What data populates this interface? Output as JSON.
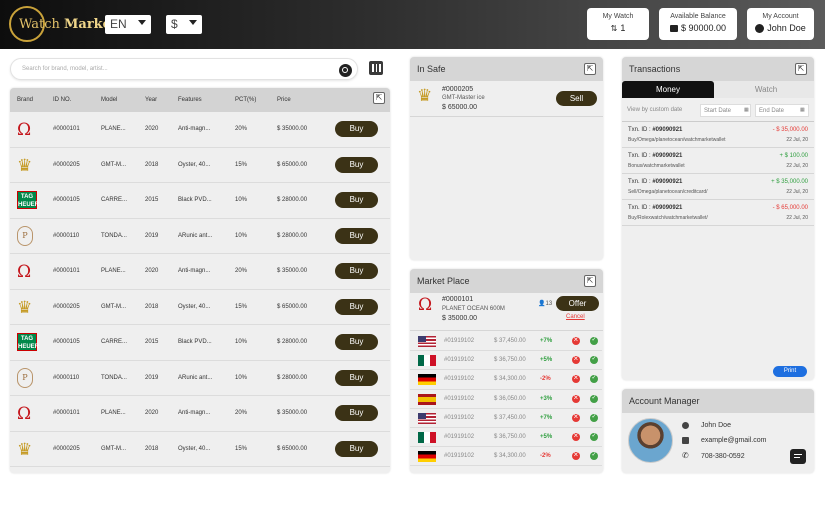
{
  "brand": {
    "logo_prefix": "W",
    "logo_rest": "atch",
    "logo_bold": "Market"
  },
  "selectors": {
    "language": "EN",
    "currency": "$"
  },
  "header_cards": {
    "watch": {
      "label": "My Watch",
      "value": "1"
    },
    "balance": {
      "label": "Available Balance",
      "value": "$ 90000.00"
    },
    "account": {
      "label": "My Account",
      "value": "John Doe"
    }
  },
  "search": {
    "placeholder": "Search for brand, model, artist..."
  },
  "table": {
    "headers": [
      "Brand",
      "ID NO.",
      "Model",
      "Year",
      "Features",
      "PCT(%)",
      "Price"
    ],
    "buy_label": "Buy",
    "rows": [
      {
        "brand": "omega",
        "id": "#0000101",
        "model": "PLANE...",
        "year": "2020",
        "features": "Anti-magn...",
        "pct": "20%",
        "price": "$ 35000.00"
      },
      {
        "brand": "rolex",
        "id": "#0000205",
        "model": "GMT-M...",
        "year": "2018",
        "features": "Oyster, 40...",
        "pct": "15%",
        "price": "$ 65000.00"
      },
      {
        "brand": "tag",
        "id": "#0000105",
        "model": "CARRE...",
        "year": "2015",
        "features": "Black PVD...",
        "pct": "10%",
        "price": "$ 28000.00"
      },
      {
        "brand": "pp",
        "id": "#0000110",
        "model": "TONDA...",
        "year": "2019",
        "features": "ARunic ant...",
        "pct": "10%",
        "price": "$ 28000.00"
      },
      {
        "brand": "omega",
        "id": "#0000101",
        "model": "PLANE...",
        "year": "2020",
        "features": "Anti-magn...",
        "pct": "20%",
        "price": "$ 35000.00"
      },
      {
        "brand": "rolex",
        "id": "#0000205",
        "model": "GMT-M...",
        "year": "2018",
        "features": "Oyster, 40...",
        "pct": "15%",
        "price": "$ 65000.00"
      },
      {
        "brand": "tag",
        "id": "#0000105",
        "model": "CARRE...",
        "year": "2015",
        "features": "Black PVD...",
        "pct": "10%",
        "price": "$ 28000.00"
      },
      {
        "brand": "pp",
        "id": "#0000110",
        "model": "TONDA...",
        "year": "2019",
        "features": "ARunic ant...",
        "pct": "10%",
        "price": "$ 28000.00"
      },
      {
        "brand": "omega",
        "id": "#0000101",
        "model": "PLANE...",
        "year": "2020",
        "features": "Anti-magn...",
        "pct": "20%",
        "price": "$ 35000.00"
      },
      {
        "brand": "rolex",
        "id": "#0000205",
        "model": "GMT-M...",
        "year": "2018",
        "features": "Oyster, 40...",
        "pct": "15%",
        "price": "$ 65000.00"
      }
    ]
  },
  "in_safe": {
    "title": "In Safe",
    "item": {
      "id": "#0000205",
      "model": "GMT-Master ice",
      "price": "$ 65000.00",
      "sell_label": "Sell"
    }
  },
  "market_place": {
    "title": "Market Place",
    "item": {
      "id": "#0000101",
      "model": "PLANET OCEAN 600M",
      "price": "$ 35000.00",
      "count": "13",
      "offer_label": "Offer",
      "cancel_label": "Cancel"
    },
    "offers": [
      {
        "flag": "us",
        "id": "#01919102",
        "price": "$ 37,450.00",
        "pct": "+7%",
        "pct_color": "#2e9e3e"
      },
      {
        "flag": "mx",
        "id": "#01919102",
        "price": "$ 36,750.00",
        "pct": "+5%",
        "pct_color": "#2e9e3e"
      },
      {
        "flag": "de",
        "id": "#01919102",
        "price": "$ 34,300.00",
        "pct": "-2%",
        "pct_color": "#e53935"
      },
      {
        "flag": "es",
        "id": "#01919102",
        "price": "$ 36,050.00",
        "pct": "+3%",
        "pct_color": "#2e9e3e"
      },
      {
        "flag": "us",
        "id": "#01919102",
        "price": "$ 37,450.00",
        "pct": "+7%",
        "pct_color": "#2e9e3e"
      },
      {
        "flag": "mx",
        "id": "#01919102",
        "price": "$ 36,750.00",
        "pct": "+5%",
        "pct_color": "#2e9e3e"
      },
      {
        "flag": "de",
        "id": "#01919102",
        "price": "$ 34,300.00",
        "pct": "-2%",
        "pct_color": "#e53935"
      }
    ]
  },
  "transactions": {
    "title": "Transactions",
    "tab_money": "Money",
    "tab_watch": "Watch",
    "filter_label": "View by custom date",
    "start_placeholder": "Start Date",
    "end_placeholder": "End Date",
    "print_label": "Print",
    "items": [
      {
        "label": "Txn. ID :",
        "id": "#09090921",
        "amount": "- $ 35,000.00",
        "color": "#e53935",
        "path": "Buy/Omega/planetocean/watchmarketwallet",
        "date": "22 Jul, 20"
      },
      {
        "label": "Txn. ID :",
        "id": "#09090921",
        "amount": "+ $ 100.00",
        "color": "#2e9e3e",
        "path": "Bonus/watchmarketwallet",
        "date": "22 Jul, 20"
      },
      {
        "label": "Txn. ID :",
        "id": "#09090921",
        "amount": "+ $ 35,000.00",
        "color": "#2e9e3e",
        "path": "Sell/Omega/planetocean/creditcard/",
        "date": "22 Jul, 20"
      },
      {
        "label": "Txn. ID :",
        "id": "#09090921",
        "amount": "- $ 65,000.00",
        "color": "#e53935",
        "path": "Buy/Rolexwatch/watchmarketwallet/",
        "date": "22 Jul, 20"
      }
    ]
  },
  "account_manager": {
    "title": "Account Manager",
    "name": "John Doe",
    "email": "example@gmail.com",
    "phone": "708-380-0592"
  },
  "colors": {
    "accent": "#3b3216",
    "positive": "#2e9e3e",
    "negative": "#e53935",
    "print": "#1e6fe0"
  }
}
